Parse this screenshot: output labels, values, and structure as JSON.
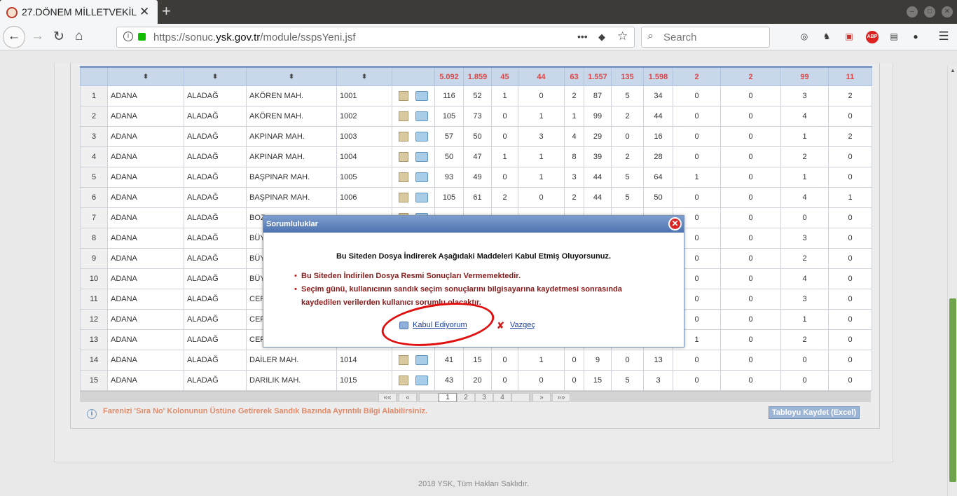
{
  "browser": {
    "tab_title": "27.DÖNEM MİLLETVEKİL",
    "url_host_prefix": "https://sonuc.",
    "url_host": "ysk.gov.tr",
    "url_path": "/module/sspsYeni.jsf",
    "search_placeholder": "Search",
    "page_actions": "•••",
    "adblock_badge": "ABP"
  },
  "table": {
    "header_sort_glyph": "⬍",
    "totals": [
      "5.092",
      "1.859",
      "45",
      "44",
      "63",
      "1.557",
      "135",
      "1.598",
      "2",
      "2",
      "99",
      "11"
    ],
    "rows": [
      {
        "no": "1",
        "il": "ADANA",
        "ilce": "ALADAĞ",
        "muhtarlik": "AKÖREN MAH.",
        "sandik": "1001",
        "v": [
          "116",
          "52",
          "1",
          "0",
          "2",
          "87",
          "5",
          "34",
          "0",
          "0",
          "3",
          "2"
        ]
      },
      {
        "no": "2",
        "il": "ADANA",
        "ilce": "ALADAĞ",
        "muhtarlik": "AKÖREN MAH.",
        "sandik": "1002",
        "v": [
          "105",
          "73",
          "0",
          "1",
          "1",
          "99",
          "2",
          "44",
          "0",
          "0",
          "4",
          "0"
        ]
      },
      {
        "no": "3",
        "il": "ADANA",
        "ilce": "ALADAĞ",
        "muhtarlik": "AKPINAR MAH.",
        "sandik": "1003",
        "v": [
          "57",
          "50",
          "0",
          "3",
          "4",
          "29",
          "0",
          "16",
          "0",
          "0",
          "1",
          "2"
        ]
      },
      {
        "no": "4",
        "il": "ADANA",
        "ilce": "ALADAĞ",
        "muhtarlik": "AKPINAR MAH.",
        "sandik": "1004",
        "v": [
          "50",
          "47",
          "1",
          "1",
          "8",
          "39",
          "2",
          "28",
          "0",
          "0",
          "2",
          "0"
        ]
      },
      {
        "no": "5",
        "il": "ADANA",
        "ilce": "ALADAĞ",
        "muhtarlik": "BAŞPINAR MAH.",
        "sandik": "1005",
        "v": [
          "93",
          "49",
          "0",
          "1",
          "3",
          "44",
          "5",
          "64",
          "1",
          "0",
          "1",
          "0"
        ]
      },
      {
        "no": "6",
        "il": "ADANA",
        "ilce": "ALADAĞ",
        "muhtarlik": "BAŞPINAR MAH.",
        "sandik": "1006",
        "v": [
          "105",
          "61",
          "2",
          "0",
          "2",
          "44",
          "5",
          "50",
          "0",
          "0",
          "4",
          "1"
        ]
      },
      {
        "no": "7",
        "il": "ADANA",
        "ilce": "ALADAĞ",
        "muhtarlik": "BOZ",
        "sandik": "",
        "v": [
          "",
          "",
          "",
          "",
          "",
          "",
          "",
          "",
          "0",
          "0",
          "0",
          "0"
        ]
      },
      {
        "no": "8",
        "il": "ADANA",
        "ilce": "ALADAĞ",
        "muhtarlik": "BÜY",
        "sandik": "",
        "v": [
          "",
          "",
          "",
          "",
          "",
          "",
          "",
          "",
          "0",
          "0",
          "3",
          "0"
        ]
      },
      {
        "no": "9",
        "il": "ADANA",
        "ilce": "ALADAĞ",
        "muhtarlik": "BÜY",
        "sandik": "",
        "v": [
          "",
          "",
          "",
          "",
          "",
          "",
          "",
          "",
          "0",
          "0",
          "2",
          "0"
        ]
      },
      {
        "no": "10",
        "il": "ADANA",
        "ilce": "ALADAĞ",
        "muhtarlik": "BÜY",
        "sandik": "",
        "v": [
          "",
          "",
          "",
          "",
          "",
          "",
          "",
          "",
          "0",
          "0",
          "4",
          "0"
        ]
      },
      {
        "no": "11",
        "il": "ADANA",
        "ilce": "ALADAĞ",
        "muhtarlik": "CER",
        "sandik": "",
        "v": [
          "",
          "",
          "",
          "",
          "",
          "",
          "",
          "",
          "0",
          "0",
          "3",
          "0"
        ]
      },
      {
        "no": "12",
        "il": "ADANA",
        "ilce": "ALADAĞ",
        "muhtarlik": "CER",
        "sandik": "",
        "v": [
          "",
          "",
          "",
          "",
          "",
          "",
          "",
          "",
          "0",
          "0",
          "1",
          "0"
        ]
      },
      {
        "no": "13",
        "il": "ADANA",
        "ilce": "ALADAĞ",
        "muhtarlik": "CER",
        "sandik": "",
        "v": [
          "",
          "",
          "",
          "",
          "",
          "",
          "",
          "",
          "1",
          "0",
          "2",
          "0"
        ]
      },
      {
        "no": "14",
        "il": "ADANA",
        "ilce": "ALADAĞ",
        "muhtarlik": "DAİLER MAH.",
        "sandik": "1014",
        "v": [
          "41",
          "15",
          "0",
          "1",
          "0",
          "9",
          "0",
          "13",
          "0",
          "0",
          "0",
          "0"
        ]
      },
      {
        "no": "15",
        "il": "ADANA",
        "ilce": "ALADAĞ",
        "muhtarlik": "DARILIK MAH.",
        "sandik": "1015",
        "v": [
          "43",
          "20",
          "0",
          "0",
          "0",
          "15",
          "5",
          "3",
          "0",
          "0",
          "0",
          "0"
        ]
      }
    ]
  },
  "pager": {
    "first": "««",
    "prev": "«",
    "pages": [
      "1",
      "2",
      "3",
      "4"
    ],
    "current": "1",
    "next": "»",
    "last": "»»"
  },
  "note": "Farenizi 'Sıra No' Kolonunun Üstüne Getirerek Sandık Bazında Ayrıntılı Bilgi Alabilirsiniz.",
  "excel_button": "Tabloyu Kaydet (Excel)",
  "footer": "2018 YSK, Tüm Hakları Saklıdır.",
  "dialog": {
    "title": "Sorumluluklar",
    "heading": "Bu Siteden Dosya İndirerek Aşağıdaki Maddeleri Kabul Etmiş Oluyorsunuz.",
    "item1": "Bu Siteden İndirilen Dosya Resmi Sonuçları Vermemektedir.",
    "item2_line1": "Seçim günü, kullanıcının sandık seçim sonuçlarını bilgisayarına kaydetmesi sonrasında",
    "item2_line2": "kaydedilen verilerden kullanıcı sorumlu olacaktır.",
    "accept": "Kabul Ediyorum",
    "cancel": "Vazgeç"
  },
  "colors": {
    "annotation_circle": "#e01010",
    "header_totals": "#dd4444",
    "dialog_header": "#4e73b0"
  }
}
